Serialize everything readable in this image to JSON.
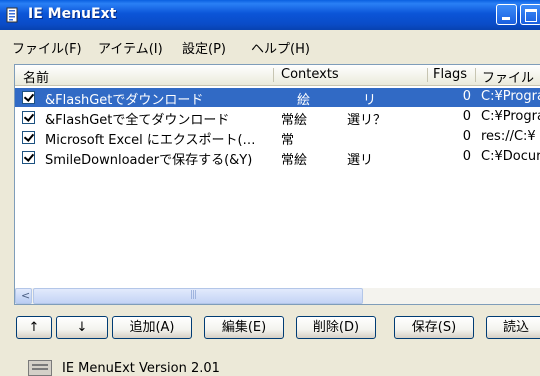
{
  "window": {
    "title": "IE MenuExt"
  },
  "menu": [
    "ファイル(F)",
    "アイテム(I)",
    "設定(P)",
    "ヘルプ(H)"
  ],
  "columns": {
    "name": "名前",
    "contexts": "Contexts",
    "flags": "Flags",
    "file": "ファイル"
  },
  "rows": [
    {
      "name": "&FlashGetでダウンロード",
      "ctx1": "絵",
      "ctx2": "リ",
      "flags": "0",
      "file": "C:¥Progra",
      "checked": true,
      "selected": true
    },
    {
      "name": "&FlashGetで全てダウンロード",
      "ctx1": "常絵",
      "ctx2": "選リ？",
      "flags": "0",
      "file": "C:¥Progra",
      "checked": true,
      "selected": false
    },
    {
      "name": "Microsoft Excel にエクスポート(…",
      "ctx1": "常",
      "ctx2": "",
      "flags": "0",
      "file": "res://C:¥",
      "checked": true,
      "selected": false
    },
    {
      "name": "SmileDownloaderで保存する(&Y)",
      "ctx1": "常絵",
      "ctx2": "選リ",
      "flags": "0",
      "file": "C:¥Docur",
      "checked": true,
      "selected": false
    }
  ],
  "buttons": {
    "up": "↑",
    "down": "↓",
    "add": "追加(A)",
    "edit": "編集(E)",
    "delete": "削除(D)",
    "save": "保存(S)",
    "load": "読込"
  },
  "status": {
    "version": "IE MenuExt Version 2.01"
  },
  "colors": {
    "titlebar": "#0a50d8",
    "selection": "#316ac5",
    "face": "#ece9d8"
  }
}
